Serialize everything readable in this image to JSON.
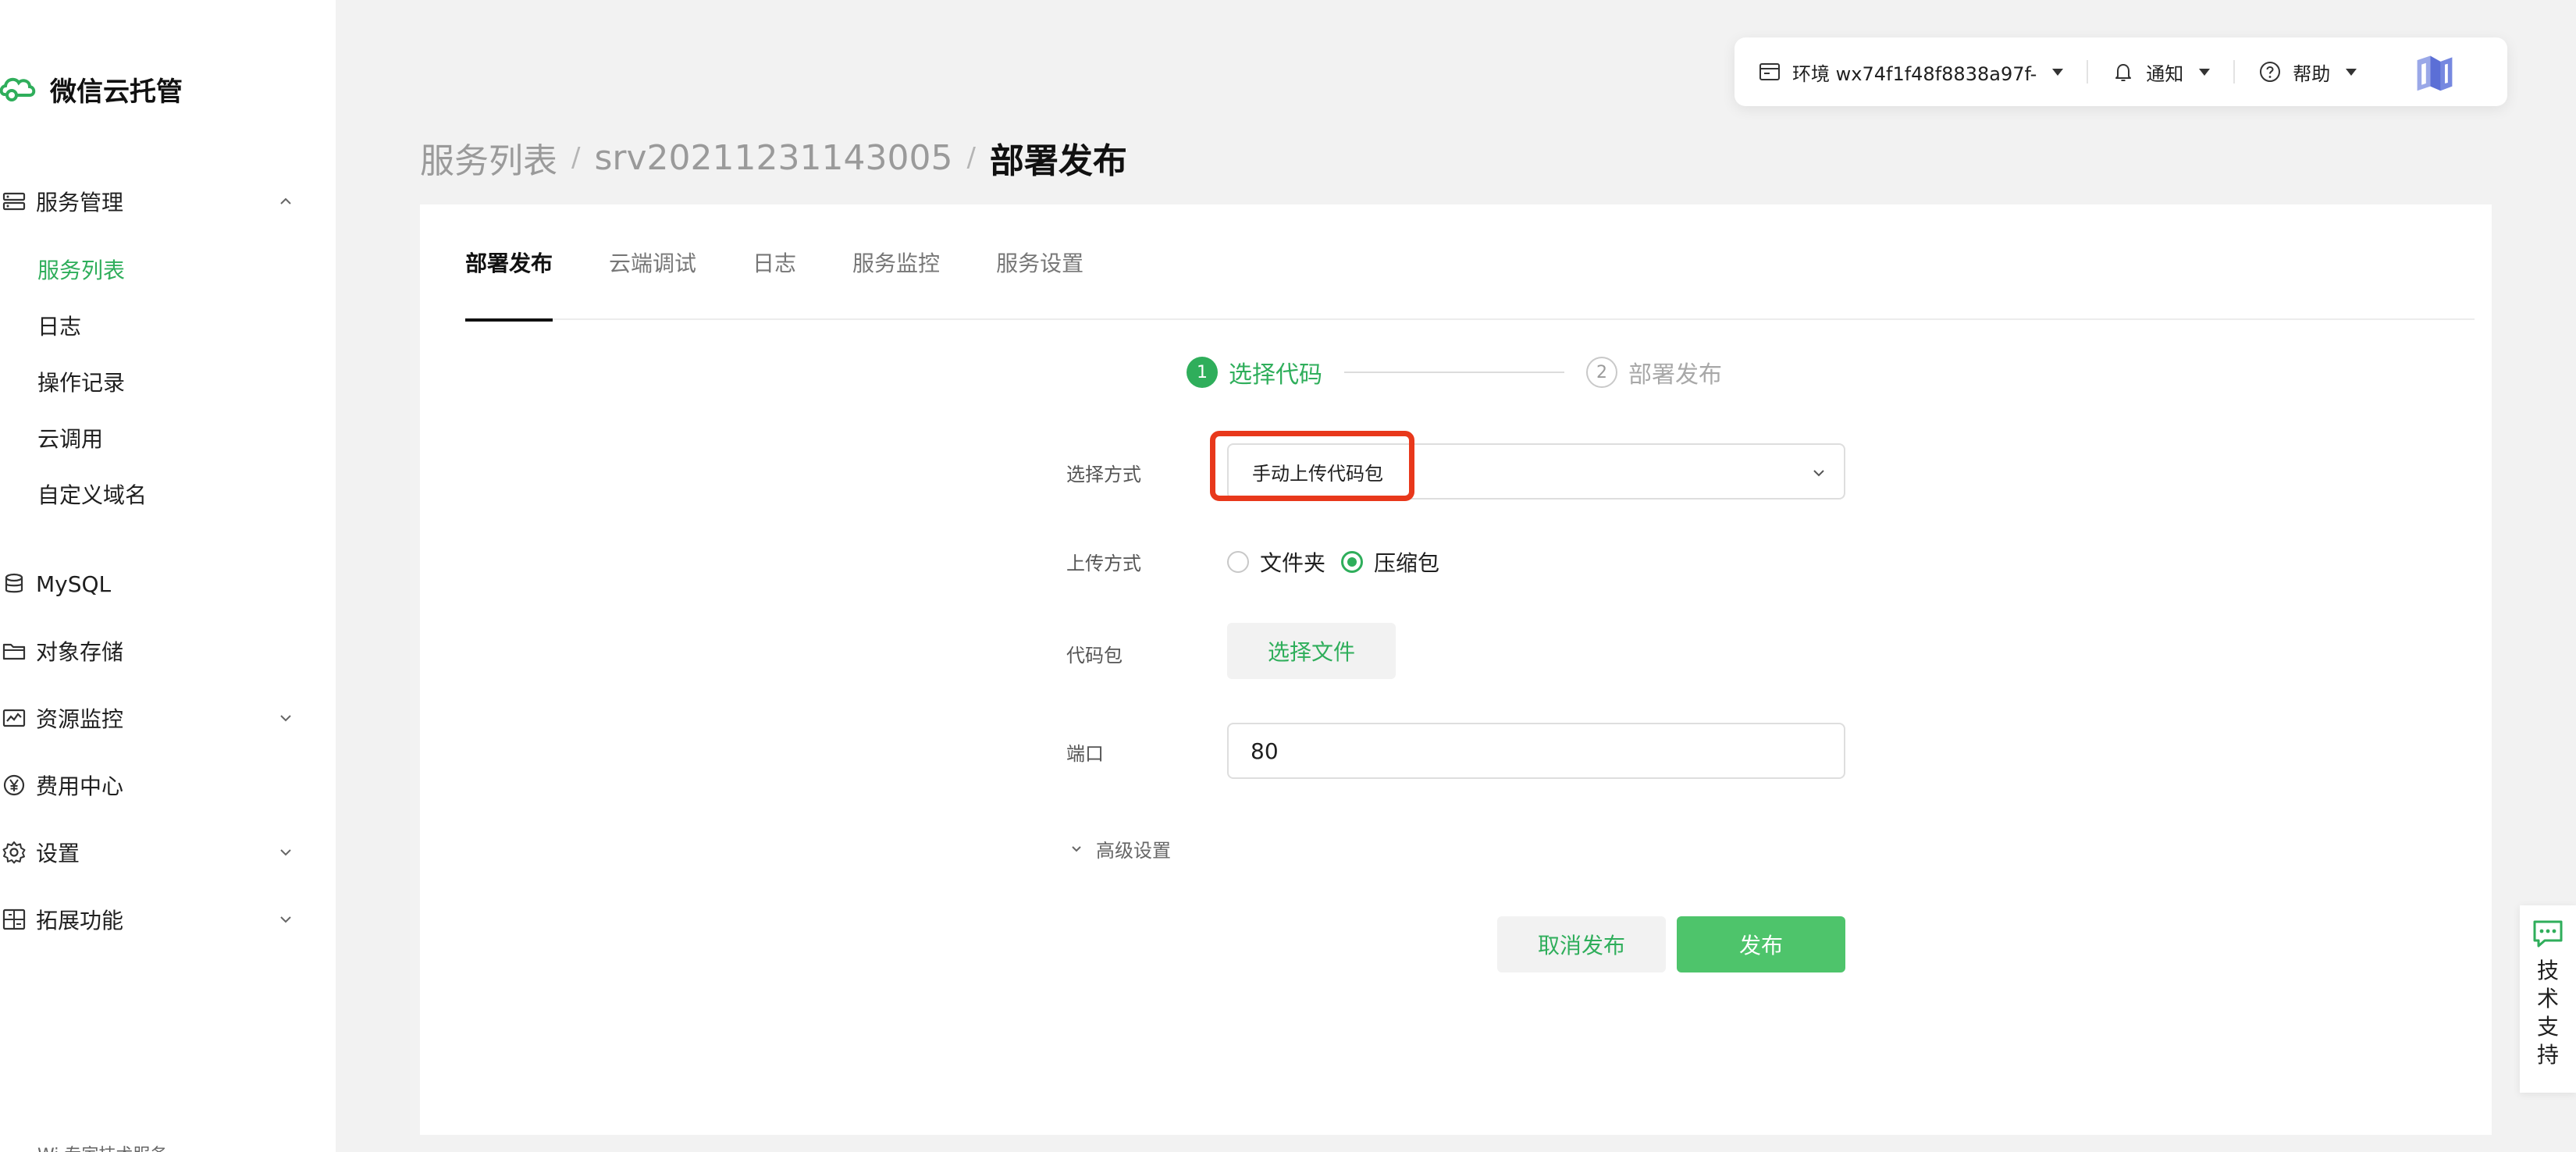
{
  "brand": {
    "name": "微信云托管",
    "color": "#2fae5b"
  },
  "sidebar": {
    "groups": [
      {
        "label": "服务管理",
        "icon": "server-icon",
        "expanded": true
      },
      {
        "label": "MySQL",
        "icon": "database-icon"
      },
      {
        "label": "对象存储",
        "icon": "folder-icon"
      },
      {
        "label": "资源监控",
        "icon": "monitor-icon",
        "expanded": false
      },
      {
        "label": "费用中心",
        "icon": "yen-icon"
      },
      {
        "label": "设置",
        "icon": "gear-icon",
        "expanded": false
      },
      {
        "label": "拓展功能",
        "icon": "extension-icon",
        "expanded": false
      }
    ],
    "sub_items": [
      {
        "label": "服务列表",
        "active": true
      },
      {
        "label": "日志"
      },
      {
        "label": "操作记录"
      },
      {
        "label": "云调用"
      },
      {
        "label": "自定义域名"
      }
    ],
    "bottom_text": "Wi 专家技术服务"
  },
  "toolbar": {
    "env_label": "环境 wx74f1f48f8838a97f-",
    "notify_label": "通知",
    "help_label": "帮助"
  },
  "breadcrumb": {
    "items": [
      "服务列表",
      "srv20211231143005"
    ],
    "current": "部署发布",
    "separator": "/"
  },
  "tabs": [
    {
      "label": "部署发布",
      "active": true
    },
    {
      "label": "云端调试"
    },
    {
      "label": "日志"
    },
    {
      "label": "服务监控"
    },
    {
      "label": "服务设置"
    }
  ],
  "steps": [
    {
      "num": "1",
      "label": "选择代码",
      "active": true
    },
    {
      "num": "2",
      "label": "部署发布",
      "active": false
    }
  ],
  "form": {
    "method_label": "选择方式",
    "method_value": "手动上传代码包",
    "upload_label": "上传方式",
    "upload_options": [
      "文件夹",
      "压缩包"
    ],
    "upload_selected": "压缩包",
    "package_label": "代码包",
    "choose_file_label": "选择文件",
    "port_label": "端口",
    "port_value": "80",
    "advanced_label": "高级设置"
  },
  "actions": {
    "cancel_label": "取消发布",
    "publish_label": "发布"
  },
  "support": {
    "label": "技术支持"
  },
  "colors": {
    "accent": "#2fae5b",
    "publish": "#4ec46b",
    "highlight": "#e8381b"
  }
}
